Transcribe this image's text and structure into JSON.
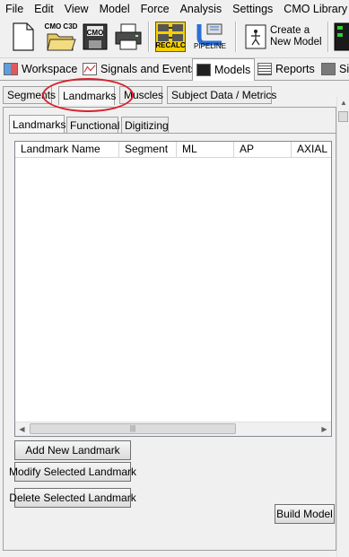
{
  "menu": [
    "File",
    "Edit",
    "View",
    "Model",
    "Force",
    "Analysis",
    "Settings",
    "CMO Library"
  ],
  "toolbar": {
    "cmo_c3d_label": "CMO C3D",
    "cmo_label": "CMO",
    "recalc_label": "RECALC",
    "pipeline_label": "PIPELINE",
    "create_model_line1": "Create a",
    "create_model_line2": "New Model"
  },
  "main_tabs": [
    "Workspace",
    "Signals and Events",
    "Models",
    "Reports",
    "Si"
  ],
  "sub_tabs": [
    "Segments",
    "Landmarks",
    "Muscles",
    "Subject Data / Metrics"
  ],
  "inner_tabs": [
    "Landmarks",
    "Functional",
    "Digitizing"
  ],
  "table": {
    "columns": [
      "Landmark Name",
      "Segment",
      "ML",
      "AP",
      "AXIAL"
    ],
    "rows": []
  },
  "buttons": {
    "add": "Add New Landmark",
    "modify": "Modify Selected Landmark",
    "delete": "Delete Selected Landmark",
    "build": "Build Model"
  },
  "colors": {
    "highlight_ellipse": "#d8202c",
    "recalc_bg": "#f5d000",
    "pipeline_blue": "#2a6fd6"
  }
}
